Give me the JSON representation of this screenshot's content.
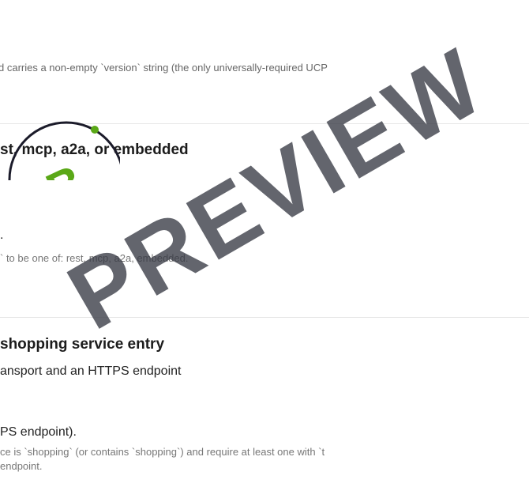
{
  "section1": {
    "note": "d carries a non-empty `version` string (the only universally-required UCP"
  },
  "section2": {
    "heading": "st, mcp, a2a, or embedded",
    "result": ".",
    "detail": "` to be one of: rest, mcp, a2a, embedded."
  },
  "section3": {
    "heading": "shopping service entry",
    "subheading": "ansport and an HTTPS endpoint",
    "result": "PS endpoint).",
    "detail_line1": "ce is `shopping` (or contains `shopping`) and require at least one with `t",
    "detail_line2": "endpoint."
  },
  "badge": {
    "letter": "B",
    "grade_color": "#5aa817"
  },
  "watermark": {
    "text": "PREVIEW"
  }
}
